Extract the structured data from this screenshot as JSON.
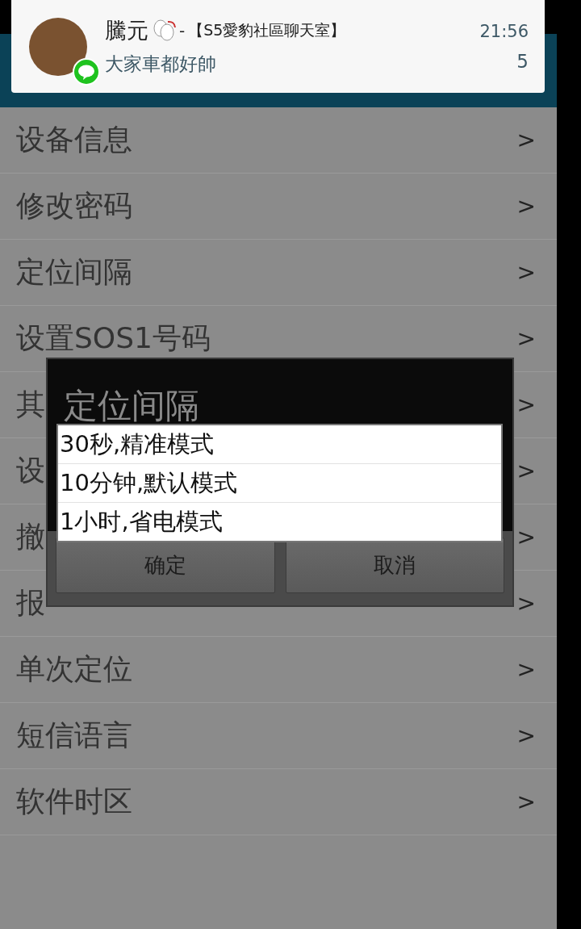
{
  "notification": {
    "sender": "騰元",
    "separator": "-",
    "group": "【S5愛豹社區聊天室】",
    "time": "21:56",
    "message": "大家車都好帥",
    "count": "5"
  },
  "menu": {
    "items": [
      {
        "label": "设备信息",
        "chevron": ">"
      },
      {
        "label": "修改密码",
        "chevron": ">"
      },
      {
        "label": "定位间隔",
        "chevron": ">"
      },
      {
        "label": "设置SOS1号码",
        "chevron": ">"
      },
      {
        "label": "其",
        "chevron": ">"
      },
      {
        "label": "设",
        "chevron": ">"
      },
      {
        "label": "撤",
        "chevron": ">"
      },
      {
        "label": "报",
        "chevron": ">"
      },
      {
        "label": "单次定位",
        "chevron": ">"
      },
      {
        "label": "短信语言",
        "chevron": ">"
      },
      {
        "label": "软件时区",
        "chevron": ">"
      }
    ]
  },
  "dialog": {
    "title": "定位间隔",
    "options": [
      "30秒,精准模式",
      "10分钟,默认模式",
      "1小时,省电模式"
    ],
    "buttons": [
      "确定",
      "取消"
    ]
  }
}
